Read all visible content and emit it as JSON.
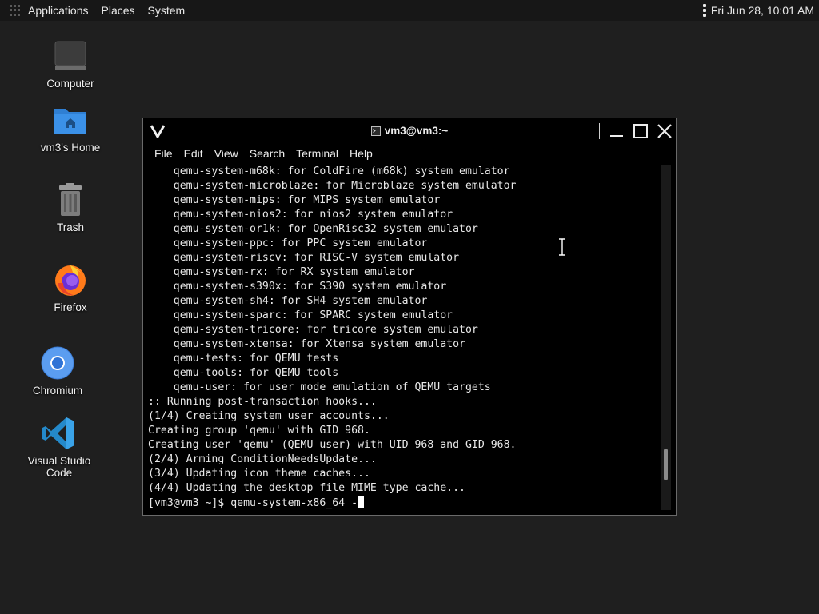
{
  "top_panel": {
    "applications_label": "Applications",
    "places_label": "Places",
    "system_label": "System",
    "clock": "Fri Jun 28, 10:01 AM"
  },
  "desktop": {
    "icons": [
      {
        "label": "Computer",
        "icon": "computer-icon"
      },
      {
        "label": "vm3's Home",
        "icon": "home-folder-icon"
      },
      {
        "label": "Trash",
        "icon": "trash-icon"
      },
      {
        "label": "Firefox",
        "icon": "firefox-icon"
      },
      {
        "label": "Chromium",
        "icon": "chromium-icon"
      },
      {
        "label": "Visual Studio Code",
        "icon": "vscode-icon"
      }
    ]
  },
  "terminal": {
    "title": "vm3@vm3:~",
    "menu": [
      "File",
      "Edit",
      "View",
      "Search",
      "Terminal",
      "Help"
    ],
    "lines": [
      "    qemu-system-m68k: for ColdFire (m68k) system emulator",
      "    qemu-system-microblaze: for Microblaze system emulator",
      "    qemu-system-mips: for MIPS system emulator",
      "    qemu-system-nios2: for nios2 system emulator",
      "    qemu-system-or1k: for OpenRisc32 system emulator",
      "    qemu-system-ppc: for PPC system emulator",
      "    qemu-system-riscv: for RISC-V system emulator",
      "    qemu-system-rx: for RX system emulator",
      "    qemu-system-s390x: for S390 system emulator",
      "    qemu-system-sh4: for SH4 system emulator",
      "    qemu-system-sparc: for SPARC system emulator",
      "    qemu-system-tricore: for tricore system emulator",
      "    qemu-system-xtensa: for Xtensa system emulator",
      "    qemu-tests: for QEMU tests",
      "    qemu-tools: for QEMU tools",
      "    qemu-user: for user mode emulation of QEMU targets",
      ":: Running post-transaction hooks...",
      "(1/4) Creating system user accounts...",
      "Creating group 'qemu' with GID 968.",
      "Creating user 'qemu' (QEMU user) with UID 968 and GID 968.",
      "(2/4) Arming ConditionNeedsUpdate...",
      "(3/4) Updating icon theme caches...",
      "(4/4) Updating the desktop file MIME type cache..."
    ],
    "prompt": "[vm3@vm3 ~]$ qemu-system-x86_64 -",
    "scroll_position": 0.92
  },
  "colors": {
    "desktop_bg": "#1f1f1f",
    "panel_bg": "#171717",
    "terminal_bg": "#000000",
    "text": "#e8e8e8"
  }
}
